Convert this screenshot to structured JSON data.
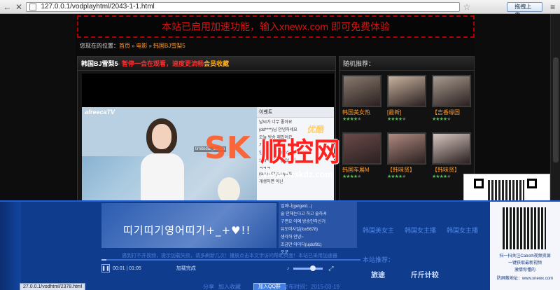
{
  "browser": {
    "url": "127.0.0.1/vodplayhtml/2043-1-1.html",
    "upload_button": "拖拽上传",
    "back_glyph": "←",
    "close_glyph": "✕",
    "star_glyph": "☆",
    "menu_glyph": "≡"
  },
  "banner": {
    "text": "本站已启用加速功能，输入xnewx.com 即可免费体验"
  },
  "breadcrumb": {
    "prefix": "您现在的位置：",
    "items": [
      "首页",
      "电影",
      "韩国BJ雪梨5"
    ],
    "separator": "»"
  },
  "player": {
    "title": "韩国BJ雪梨5",
    "notice": " - 暂停一会在观看，速度更流畅",
    "favorite": "会员收藏",
    "video_logo": "afreecaTV",
    "video_caption": "timitodiZ_bacon",
    "chat_head": "이벤트",
    "chat_lines": [
      {
        "nick": "",
        "text": "날씨가 너무 좋아요"
      },
      {
        "nick": "",
        "text": "(dd****)님 안녕하세요"
      },
      {
        "nick": "",
        "text": "오늘 방송 재밌어요"
      },
      {
        "nick": "",
        "text": "기분이 좋아요"
      },
      {
        "nick": "양양양",
        "text": "(oldefc00) 님이 입장"
      },
      {
        "nick": "",
        "text": "1 해서 너무 좋습니다"
      },
      {
        "nick": "",
        "text": "ㅋㅋㅋ"
      },
      {
        "nick": "",
        "text": "(sunyvill)(sunyvill)"
      },
      {
        "nick": "",
        "text": "개생하면 아닌"
      }
    ]
  },
  "lower": {
    "hangul": "띠기띠기영어띠기+_+♥!!",
    "progress_info": "遇到打不开视频，提示加载失败，请多刷新几次！播放点击本文字访问帮助页面！本站已采用加速器",
    "time": "00:01 | 01:05",
    "loaded": "加载完成",
    "seek_fraction": 0.02,
    "volume_fraction": 0.66,
    "chat_lines": [
      {
        "nick": "",
        "text": "얼마나(gelgeld...)"
      },
      {
        "nick": "",
        "text": "술 안해는다고 하고 술하셔"
      },
      {
        "nick": "",
        "text": "구면요 아예 방송안하신거"
      },
      {
        "nick": "",
        "text": "유도미사일(fox5678)"
      },
      {
        "nick": "",
        "text": "생각하 안녕~"
      },
      {
        "nick": "",
        "text": "조금만 아이디(ujdof81)"
      },
      {
        "nick": "",
        "text": "오군"
      }
    ],
    "recommend_heading": "本站推荐：",
    "rec_items": [
      "韩国美女主",
      "韩国女主播",
      "韩国女主播"
    ],
    "logos": [
      "旅途",
      "斤斤计较"
    ],
    "qr_lines": [
      "扫一扫关注Caboth视频资源",
      "一键获取最新视频",
      "激情你懂的",
      "防屏蔽地址：www.xnewx.com"
    ],
    "status_url": "27.0.0.1/vodhtml/2378.html",
    "share": "分享",
    "fav": "加入收藏",
    "qq": "加入QQ群",
    "pub_date": "发布时间：2015-03-19"
  },
  "recommend": {
    "heading": "随机推荐：",
    "items": [
      {
        "title": "韩国美女热",
        "stars": 4
      },
      {
        "title": "[最新]",
        "stars": 4
      },
      {
        "title": "【吉香缘国",
        "stars": 4
      },
      {
        "title": "韩国车展M",
        "stars": 4
      },
      {
        "title": "【韩味贤】",
        "stars": 4
      },
      {
        "title": "【韩味贤】",
        "stars": 4
      }
    ],
    "colors": [
      "#8a7a6e",
      "#c9b39f",
      "#a89a8e",
      "#6c4a4a",
      "#b08a80",
      "#d8c7c0"
    ]
  },
  "watermark": {
    "brand_latin": "SK",
    "brand_cn": "顺控网",
    "url": "www.hzskdz.com",
    "badge": "优酷"
  },
  "colors": {
    "banner_text": "#d71414",
    "link_orange": "#ff9a2e",
    "overlay_blue": "#0f3c8c"
  }
}
